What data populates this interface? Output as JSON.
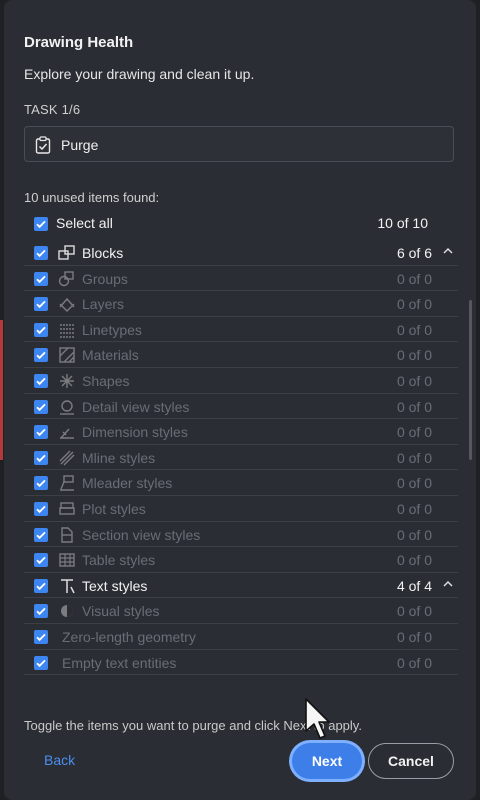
{
  "dialog": {
    "title": "Drawing Health",
    "subtitle": "Explore your drawing and clean it up.",
    "task_label": "TASK 1/6",
    "task_name": "Purge",
    "found_text": "10 unused items found:",
    "select_all": {
      "label": "Select all",
      "count": "10 of 10",
      "checked": true
    },
    "items": [
      {
        "label": "Blocks",
        "count": "6 of 6",
        "active": true,
        "icon": "blocks-icon",
        "expandable": true
      },
      {
        "label": "Groups",
        "count": "0 of 0",
        "active": false,
        "icon": "groups-icon"
      },
      {
        "label": "Layers",
        "count": "0 of 0",
        "active": false,
        "icon": "layers-icon"
      },
      {
        "label": "Linetypes",
        "count": "0 of 0",
        "active": false,
        "icon": "linetypes-icon"
      },
      {
        "label": "Materials",
        "count": "0 of 0",
        "active": false,
        "icon": "materials-icon"
      },
      {
        "label": "Shapes",
        "count": "0 of 0",
        "active": false,
        "icon": "shapes-icon"
      },
      {
        "label": "Detail view styles",
        "count": "0 of 0",
        "active": false,
        "icon": "detail-view-icon"
      },
      {
        "label": "Dimension styles",
        "count": "0 of 0",
        "active": false,
        "icon": "dimension-icon"
      },
      {
        "label": "Mline styles",
        "count": "0 of 0",
        "active": false,
        "icon": "mline-icon"
      },
      {
        "label": "Mleader styles",
        "count": "0 of 0",
        "active": false,
        "icon": "mleader-icon"
      },
      {
        "label": "Plot styles",
        "count": "0 of 0",
        "active": false,
        "icon": "plot-icon"
      },
      {
        "label": "Section view styles",
        "count": "0 of 0",
        "active": false,
        "icon": "section-view-icon"
      },
      {
        "label": "Table styles",
        "count": "0 of 0",
        "active": false,
        "icon": "table-icon"
      },
      {
        "label": "Text styles",
        "count": "4 of 4",
        "active": true,
        "icon": "text-styles-icon",
        "expandable": true
      },
      {
        "label": "Visual styles",
        "count": "0 of 0",
        "active": false,
        "icon": "visual-styles-icon"
      },
      {
        "label": "Zero-length geometry",
        "count": "0 of 0",
        "active": false,
        "icon": ""
      },
      {
        "label": "Empty text entities",
        "count": "0 of 0",
        "active": false,
        "icon": ""
      }
    ],
    "hint": "Toggle the items you want to purge and click Next to apply.",
    "buttons": {
      "back": "Back",
      "next": "Next",
      "cancel": "Cancel"
    }
  },
  "colors": {
    "accent": "#3d85f0",
    "panel": "#2b2d34",
    "dim_text": "#6a6d75"
  }
}
